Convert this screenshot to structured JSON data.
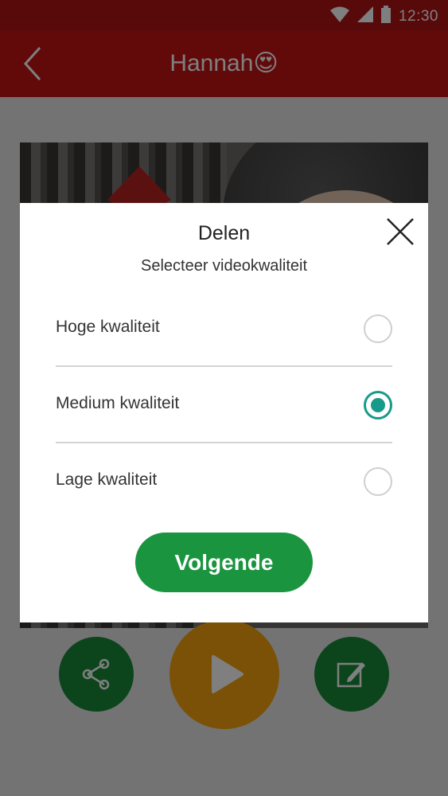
{
  "status_bar": {
    "time": "12:30",
    "icons": [
      "wifi-icon",
      "signal-icon",
      "battery-icon"
    ]
  },
  "app_bar": {
    "title": "Hannah",
    "emoji": "😍",
    "back_icon": "back-chevron-icon"
  },
  "actions": {
    "share_icon": "share-icon",
    "play_icon": "play-icon",
    "edit_icon": "edit-icon"
  },
  "dialog": {
    "title": "Delen",
    "subtitle": "Selecteer videokwaliteit",
    "close_icon": "close-icon",
    "options": [
      {
        "label": "Hoge kwaliteit",
        "selected": false
      },
      {
        "label": "Medium kwaliteit",
        "selected": true
      },
      {
        "label": "Lage kwaliteit",
        "selected": false
      }
    ],
    "next_label": "Volgende"
  },
  "colors": {
    "app_bar": "#c41414",
    "primary_green": "#1b9440",
    "radio_accent": "#179a8a",
    "play_orange": "#f5a20e"
  }
}
